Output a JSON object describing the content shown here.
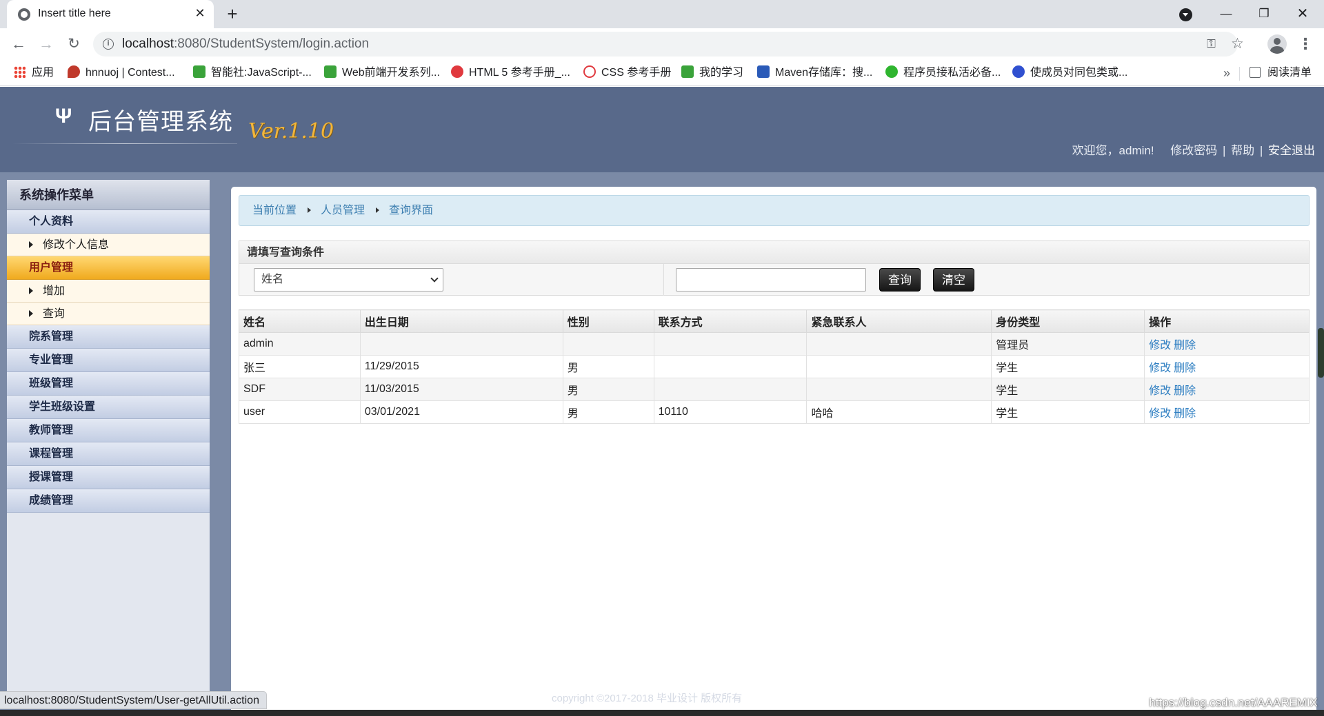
{
  "browser": {
    "tab_title": "Insert title here",
    "tab_close": "✕",
    "new_tab": "+",
    "url_host": "localhost",
    "url_path": ":8080/StudentSystem/login.action",
    "window_min": "—",
    "window_max": "❐",
    "window_close": "✕",
    "back": "←",
    "forward": "→",
    "reload": "↻",
    "key_icon": "⚿",
    "star_icon": "☆",
    "menu": "⋮",
    "bookmarks": [
      {
        "label": "应用",
        "color": "#ea4335"
      },
      {
        "label": "hnnuoj | Contest...",
        "color": "#d33"
      },
      {
        "label": "智能社:JavaScript-...",
        "color": "#3aa33a"
      },
      {
        "label": "Web前端开发系列...",
        "color": "#3aa33a"
      },
      {
        "label": "HTML 5 参考手册_...",
        "color": "#e0393e"
      },
      {
        "label": "CSS 参考手册",
        "color": "#e0393e"
      },
      {
        "label": "我的学习",
        "color": "#3aa33a"
      },
      {
        "label": "Maven存储库：搜...",
        "color": "#2a5ab8"
      },
      {
        "label": "程序员接私活必备...",
        "color": "#2fb52f"
      },
      {
        "label": "使成员对同包类或...",
        "color": "#3050d0"
      }
    ],
    "bookmarks_more": "»",
    "reading_list": "阅读清单",
    "status_url": "localhost:8080/StudentSystem/User-getAllUtil.action"
  },
  "header": {
    "logo_icon": "Ψ",
    "title": "后台管理系统",
    "version": "Ver.1.10",
    "welcome": "欢迎您，admin!",
    "change_password": "修改密码",
    "help": "帮助",
    "logout": "安全退出",
    "sep": "|"
  },
  "sidebar": {
    "title": "系统操作菜单",
    "items": [
      {
        "type": "menu",
        "label": "个人资料",
        "name": "sidebar-item-profile"
      },
      {
        "type": "sub",
        "label": "修改个人信息",
        "name": "sidebar-subitem-edit-info"
      },
      {
        "type": "menu",
        "label": "用户管理",
        "name": "sidebar-item-user-management",
        "active": true
      },
      {
        "type": "sub",
        "label": "增加",
        "name": "sidebar-subitem-add"
      },
      {
        "type": "sub",
        "label": "查询",
        "name": "sidebar-subitem-query"
      },
      {
        "type": "menu",
        "label": "院系管理",
        "name": "sidebar-item-department"
      },
      {
        "type": "menu",
        "label": "专业管理",
        "name": "sidebar-item-major"
      },
      {
        "type": "menu",
        "label": "班级管理",
        "name": "sidebar-item-class"
      },
      {
        "type": "menu",
        "label": "学生班级设置",
        "name": "sidebar-item-student-class"
      },
      {
        "type": "menu",
        "label": "教师管理",
        "name": "sidebar-item-teacher"
      },
      {
        "type": "menu",
        "label": "课程管理",
        "name": "sidebar-item-course"
      },
      {
        "type": "menu",
        "label": "授课管理",
        "name": "sidebar-item-teaching"
      },
      {
        "type": "menu",
        "label": "成绩管理",
        "name": "sidebar-item-grades"
      }
    ]
  },
  "breadcrumb": [
    "当前位置",
    "人员管理",
    "查询界面"
  ],
  "query": {
    "title": "请填写查询条件",
    "select_value": "姓名",
    "input_value": "",
    "query_button": "查询",
    "clear_button": "清空"
  },
  "table": {
    "headers": [
      "姓名",
      "出生日期",
      "性别",
      "联系方式",
      "紧急联系人",
      "身份类型",
      "操作"
    ],
    "rows": [
      [
        "admin",
        "",
        "",
        "",
        "",
        "管理员"
      ],
      [
        "张三",
        "11/29/2015",
        "男",
        "",
        "",
        "学生"
      ],
      [
        "SDF",
        "11/03/2015",
        "男",
        "",
        "",
        "学生"
      ],
      [
        "user",
        "03/01/2021",
        "男",
        "10110",
        "哈哈",
        "学生"
      ]
    ],
    "edit_label": "修改",
    "delete_label": "删除"
  },
  "footer": {
    "copyright": "copyright ©2017-2018 毕业设计 版权所有",
    "watermark": "https://blog.csdn.net/AAAREMIX"
  }
}
